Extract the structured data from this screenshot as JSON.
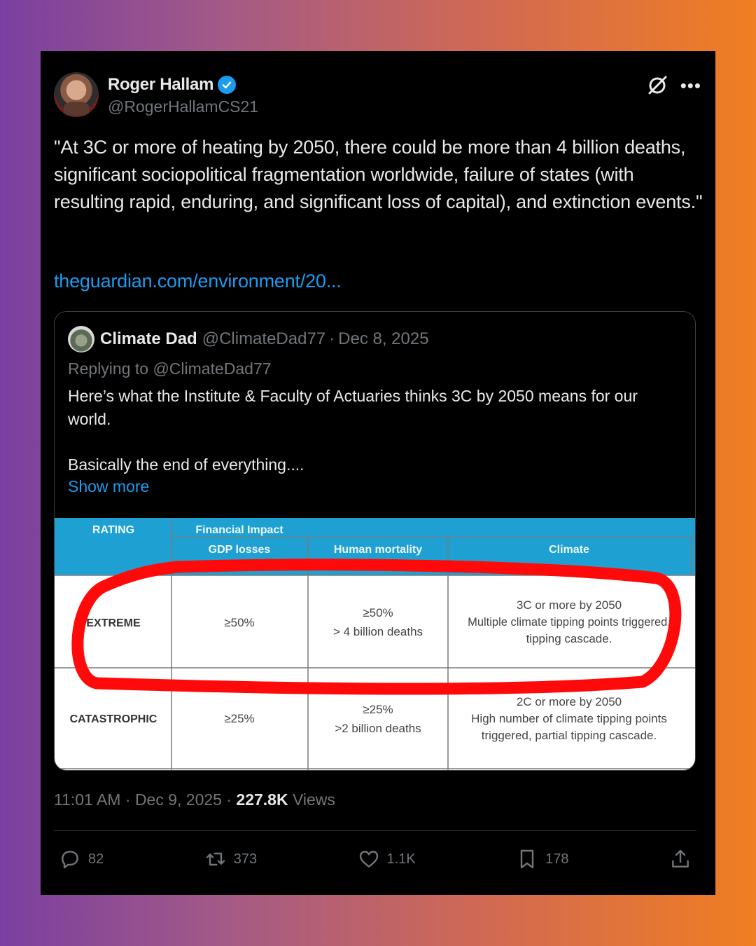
{
  "tweet": {
    "author_name": "Roger Hallam",
    "author_handle": "@RogerHallamCS21",
    "text": "\"At 3C or more of heating by 2050, there could be more than 4 billion deaths, significant sociopolitical fragmentation worldwide, failure of states (with resulting rapid, enduring, and significant loss of capital), and extinction events.\"",
    "link": "theguardian.com/environment/20...",
    "time": "11:01 AM",
    "date": "Dec 9, 2025",
    "views_count": "227.8K",
    "views_label": "Views"
  },
  "quote": {
    "author_name": "Climate Dad",
    "author_handle": "@ClimateDad77",
    "dot": "·",
    "date": "Dec 8, 2025",
    "replying": "Replying to @ClimateDad77",
    "paragraph1": "Here’s what the Institute & Faculty of Actuaries thinks 3C by 2050 means for our world.",
    "paragraph2": "Basically the end of everything....",
    "show_more": "Show more"
  },
  "table": {
    "header_rating": "RATING",
    "header_financial": "Financial Impact",
    "header_gdp": "GDP losses",
    "header_mortality": "Human mortality",
    "header_climate": "Climate",
    "rows": [
      {
        "rating": "EXTREME",
        "gdp": "≥50%",
        "mortality_1": "≥50%",
        "mortality_2": "> 4 billion deaths",
        "climate_1": "3C or more by 2050",
        "climate_2": "Multiple climate tipping points triggered,",
        "climate_3": "tipping cascade."
      },
      {
        "rating": "CATASTROPHIC",
        "gdp": "≥25%",
        "mortality_1": "≥25%",
        "mortality_2": ">2 billion deaths",
        "climate_1": "2C or more by 2050",
        "climate_2": "High number of climate tipping points",
        "climate_3": "triggered, partial tipping cascade."
      }
    ]
  },
  "actions": {
    "replies": "82",
    "reposts": "373",
    "likes": "1.1K",
    "bookmarks": "178"
  },
  "colors": {
    "background": "#000000",
    "accent": "#1d9bf0",
    "muted": "#71767b",
    "table_header": "#1ea1d2",
    "highlight": "#ff0000"
  },
  "icons": [
    "verified-badge-icon",
    "grok-icon",
    "more-icon",
    "reply-icon",
    "repost-icon",
    "like-icon",
    "bookmark-icon",
    "share-icon"
  ]
}
